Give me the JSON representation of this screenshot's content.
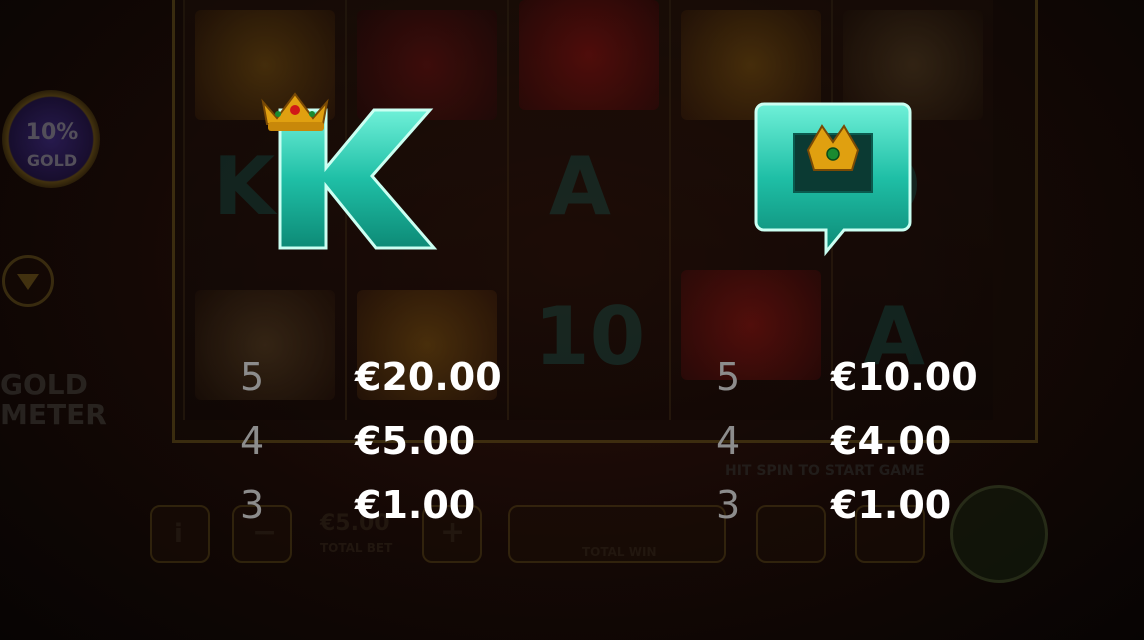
{
  "background": {
    "gold_meter": {
      "percent_label": "10%",
      "gold_label": "GOLD",
      "title_line1": "GOLD",
      "title_line2": "METER"
    },
    "controls": {
      "total_bet_value": "€5.00",
      "total_bet_label": "TOTAL BET",
      "total_win_label": "TOTAL WIN",
      "hint": "HIT SPIN TO START GAME",
      "info_label": "i",
      "minus_label": "−",
      "plus_label": "+"
    },
    "ghost_symbols": [
      "K",
      "A",
      "10",
      "Q",
      "10",
      "A"
    ]
  },
  "paytable": {
    "symbols": [
      {
        "name": "K",
        "letter": "K",
        "color": "#1fbfa6",
        "payouts": [
          {
            "count": "5",
            "value": "€20.00"
          },
          {
            "count": "4",
            "value": "€5.00"
          },
          {
            "count": "3",
            "value": "€1.00"
          }
        ]
      },
      {
        "name": "Q",
        "letter": "Q",
        "color": "#1fbfa6",
        "payouts": [
          {
            "count": "5",
            "value": "€10.00"
          },
          {
            "count": "4",
            "value": "€4.00"
          },
          {
            "count": "3",
            "value": "€1.00"
          }
        ]
      }
    ]
  }
}
